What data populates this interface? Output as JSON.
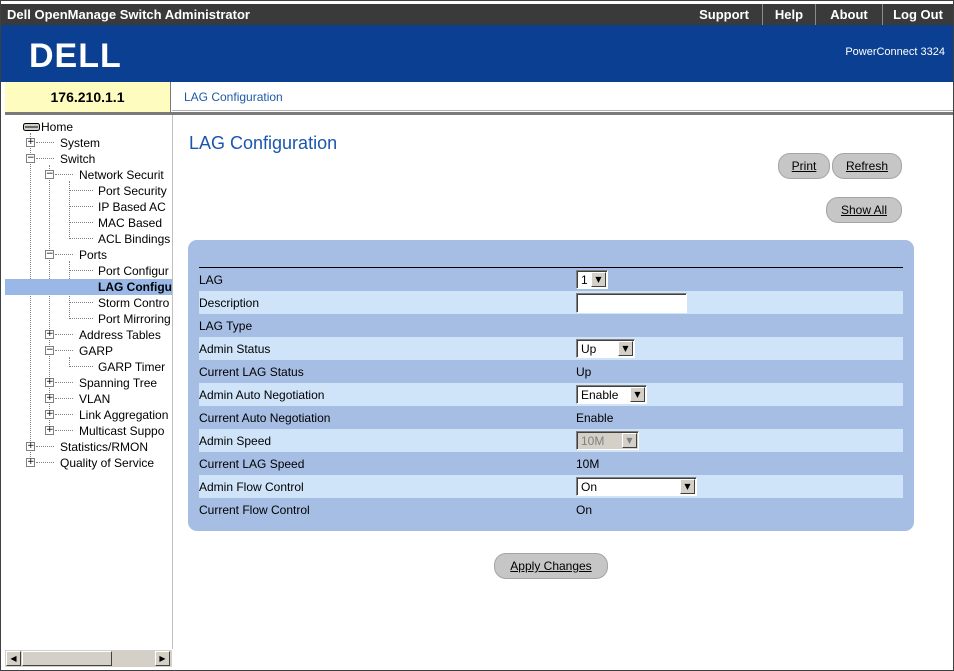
{
  "header": {
    "app_title": "Dell OpenManage Switch Administrator",
    "nav": [
      "Support",
      "Help",
      "About",
      "Log Out"
    ],
    "logo_text": "DELL",
    "product": "PowerConnect 3324"
  },
  "address": {
    "ip": "176.210.1.1",
    "breadcrumb": "LAG Configuration"
  },
  "tree": {
    "home": "Home",
    "system": "System",
    "switch": "Switch",
    "network_security": "Network Securit",
    "port_security": "Port Security",
    "ip_based_acl": "IP Based AC",
    "mac_based": "MAC Based",
    "acl_bindings": "ACL Bindings",
    "ports": "Ports",
    "port_configuration": "Port Configur",
    "lag_configuration": "LAG Configu",
    "storm_control": "Storm Contro",
    "port_mirroring": "Port Mirroring",
    "address_tables": "Address Tables",
    "garp": "GARP",
    "garp_timers": "GARP Timer",
    "spanning_tree": "Spanning Tree",
    "vlan": "VLAN",
    "link_aggregation": "Link Aggregation",
    "multicast_support": "Multicast Suppo",
    "statistics_rmon": "Statistics/RMON",
    "quality_of_service": "Quality of Service"
  },
  "page": {
    "title": "LAG Configuration",
    "print": "Print",
    "refresh": "Refresh",
    "show_all": "Show All",
    "apply": "Apply Changes"
  },
  "form": {
    "lag_label": "LAG",
    "lag_value": "1",
    "description_label": "Description",
    "description_value": "",
    "lag_type_label": "LAG Type",
    "lag_type_value": "",
    "admin_status_label": "Admin Status",
    "admin_status_value": "Up",
    "current_lag_status_label": "Current LAG Status",
    "current_lag_status_value": "Up",
    "admin_auto_neg_label": "Admin Auto Negotiation",
    "admin_auto_neg_value": "Enable",
    "current_auto_neg_label": "Current Auto Negotiation",
    "current_auto_neg_value": "Enable",
    "admin_speed_label": "Admin Speed",
    "admin_speed_value": "10M",
    "current_lag_speed_label": "Current LAG Speed",
    "current_lag_speed_value": "10M",
    "admin_flow_control_label": "Admin Flow Control",
    "admin_flow_control_value": "On",
    "current_flow_control_label": "Current Flow Control",
    "current_flow_control_value": "On"
  },
  "colors": {
    "title_bar": "#3a3a3a",
    "brand_bar": "#0a3f92",
    "ip_box": "#fffcc0",
    "panel": "#a6bde4",
    "row_light": "#cfe3f9",
    "tree_selected": "#99b8e8",
    "page_title": "#1a55b0"
  },
  "icons": {
    "tree_root": "drive-icon",
    "expanded": "minus-box-icon",
    "collapsed": "plus-box-icon",
    "dropdown": "triangle-down-icon",
    "scroll_left": "triangle-left-icon",
    "scroll_right": "triangle-right-icon"
  }
}
